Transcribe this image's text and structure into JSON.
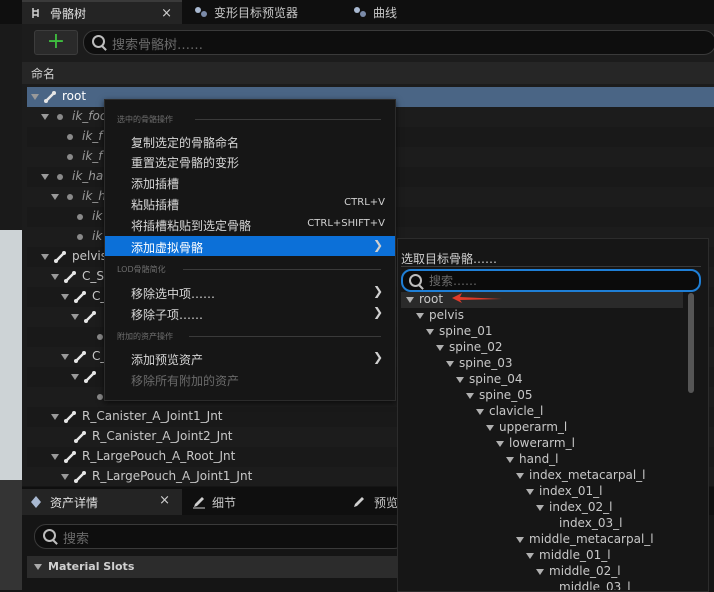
{
  "top_tabs": [
    {
      "label": "骨骼树",
      "icon": "skeleton-tree-icon",
      "active": true
    },
    {
      "label": "变形目标预览器",
      "icon": "morph-target-icon",
      "active": false
    },
    {
      "label": "曲线",
      "icon": "curve-icon",
      "active": false
    }
  ],
  "close_glyph": "×",
  "add_button": "+",
  "search": {
    "placeholder": "搜索骨骼树……"
  },
  "column_header": "命名",
  "tree": [
    {
      "label": "root",
      "kind": "bone",
      "depth": 0,
      "selected": true
    },
    {
      "label": "ik_foo",
      "kind": "dot",
      "depth": 1,
      "italic": true
    },
    {
      "label": "ik_f",
      "kind": "dot",
      "depth": 2,
      "italic": true
    },
    {
      "label": "ik_f",
      "kind": "dot",
      "depth": 2,
      "italic": true
    },
    {
      "label": "ik_ha",
      "kind": "dot",
      "depth": 1,
      "italic": true
    },
    {
      "label": "ik_h",
      "kind": "dot",
      "depth": 2,
      "italic": true
    },
    {
      "label": "ik",
      "kind": "dot",
      "depth": 3,
      "italic": true
    },
    {
      "label": "ik",
      "kind": "dot",
      "depth": 3,
      "italic": true
    },
    {
      "label": "pelvis",
      "kind": "bone",
      "depth": 1
    },
    {
      "label": "C_S",
      "kind": "bone",
      "depth": 2
    },
    {
      "label": "C_",
      "kind": "bone",
      "depth": 3
    },
    {
      "label": "",
      "kind": "bone",
      "depth": 4
    },
    {
      "label": "",
      "kind": "dot",
      "depth": 5
    },
    {
      "label": "C_",
      "kind": "bone",
      "depth": 3
    },
    {
      "label": "",
      "kind": "bone",
      "depth": 4
    },
    {
      "label": "",
      "kind": "dot",
      "depth": 5
    },
    {
      "label": "R_Canister_A_Joint1_Jnt",
      "kind": "bone",
      "depth": 2
    },
    {
      "label": "R_Canister_A_Joint2_Jnt",
      "kind": "bone",
      "depth": 3
    },
    {
      "label": "R_LargePouch_A_Root_Jnt",
      "kind": "bone",
      "depth": 2
    },
    {
      "label": "R_LargePouch_A_Joint1_Jnt",
      "kind": "bone",
      "depth": 3
    }
  ],
  "context_menu": {
    "sections": [
      {
        "title": "选中的骨骼操作",
        "items": [
          {
            "label": "复制选定的骨骼命名"
          },
          {
            "label": "重置选定骨骼的变形"
          },
          {
            "label": "添加插槽"
          },
          {
            "label": "粘贴插槽",
            "shortcut": "CTRL+V"
          },
          {
            "label": "将插槽粘贴到选定骨骼",
            "shortcut": "CTRL+SHIFT+V"
          },
          {
            "label": "添加虚拟骨骼",
            "submenu": true,
            "highlighted": true
          }
        ]
      },
      {
        "title": "LOD骨骼简化",
        "items": [
          {
            "label": "移除选中项……",
            "submenu": true
          },
          {
            "label": "移除子项……",
            "submenu": true
          }
        ]
      },
      {
        "title": "附加的资产操作",
        "items": [
          {
            "label": "添加预览资产",
            "submenu": true
          },
          {
            "label": "移除所有附加的资产",
            "disabled": true
          }
        ]
      }
    ]
  },
  "submenu": {
    "title": "选取目标骨骼……",
    "search_placeholder": "搜索……",
    "bones": [
      {
        "label": "root",
        "depth": 0
      },
      {
        "label": "pelvis",
        "depth": 1
      },
      {
        "label": "spine_01",
        "depth": 2
      },
      {
        "label": "spine_02",
        "depth": 3
      },
      {
        "label": "spine_03",
        "depth": 4
      },
      {
        "label": "spine_04",
        "depth": 5
      },
      {
        "label": "spine_05",
        "depth": 6
      },
      {
        "label": "clavicle_l",
        "depth": 7
      },
      {
        "label": "upperarm_l",
        "depth": 8
      },
      {
        "label": "lowerarm_l",
        "depth": 9
      },
      {
        "label": "hand_l",
        "depth": 10
      },
      {
        "label": "index_metacarpal_l",
        "depth": 11
      },
      {
        "label": "index_01_l",
        "depth": 12
      },
      {
        "label": "index_02_l",
        "depth": 13
      },
      {
        "label": "index_03_l",
        "depth": 14,
        "leaf": true
      },
      {
        "label": "middle_metacarpal_l",
        "depth": 11
      },
      {
        "label": "middle_01_l",
        "depth": 12
      },
      {
        "label": "middle_02_l",
        "depth": 13
      },
      {
        "label": "middle_03_l",
        "depth": 14,
        "leaf": true
      }
    ]
  },
  "bottom_tabs": [
    {
      "label": "资产详情",
      "icon": "asset-details-icon",
      "active": true
    },
    {
      "label": "细节",
      "icon": "details-pencil-icon",
      "active": false
    },
    {
      "label": "预览",
      "icon": "preview-icon",
      "active": false
    }
  ],
  "bottom_search": {
    "placeholder": "搜索"
  },
  "material_slots": "Material Slots",
  "colors": {
    "selection": "#4a6585",
    "menu_highlight": "#0c70d8",
    "add_green": "#3fbf3f",
    "annotation_red": "#e03a2a"
  }
}
